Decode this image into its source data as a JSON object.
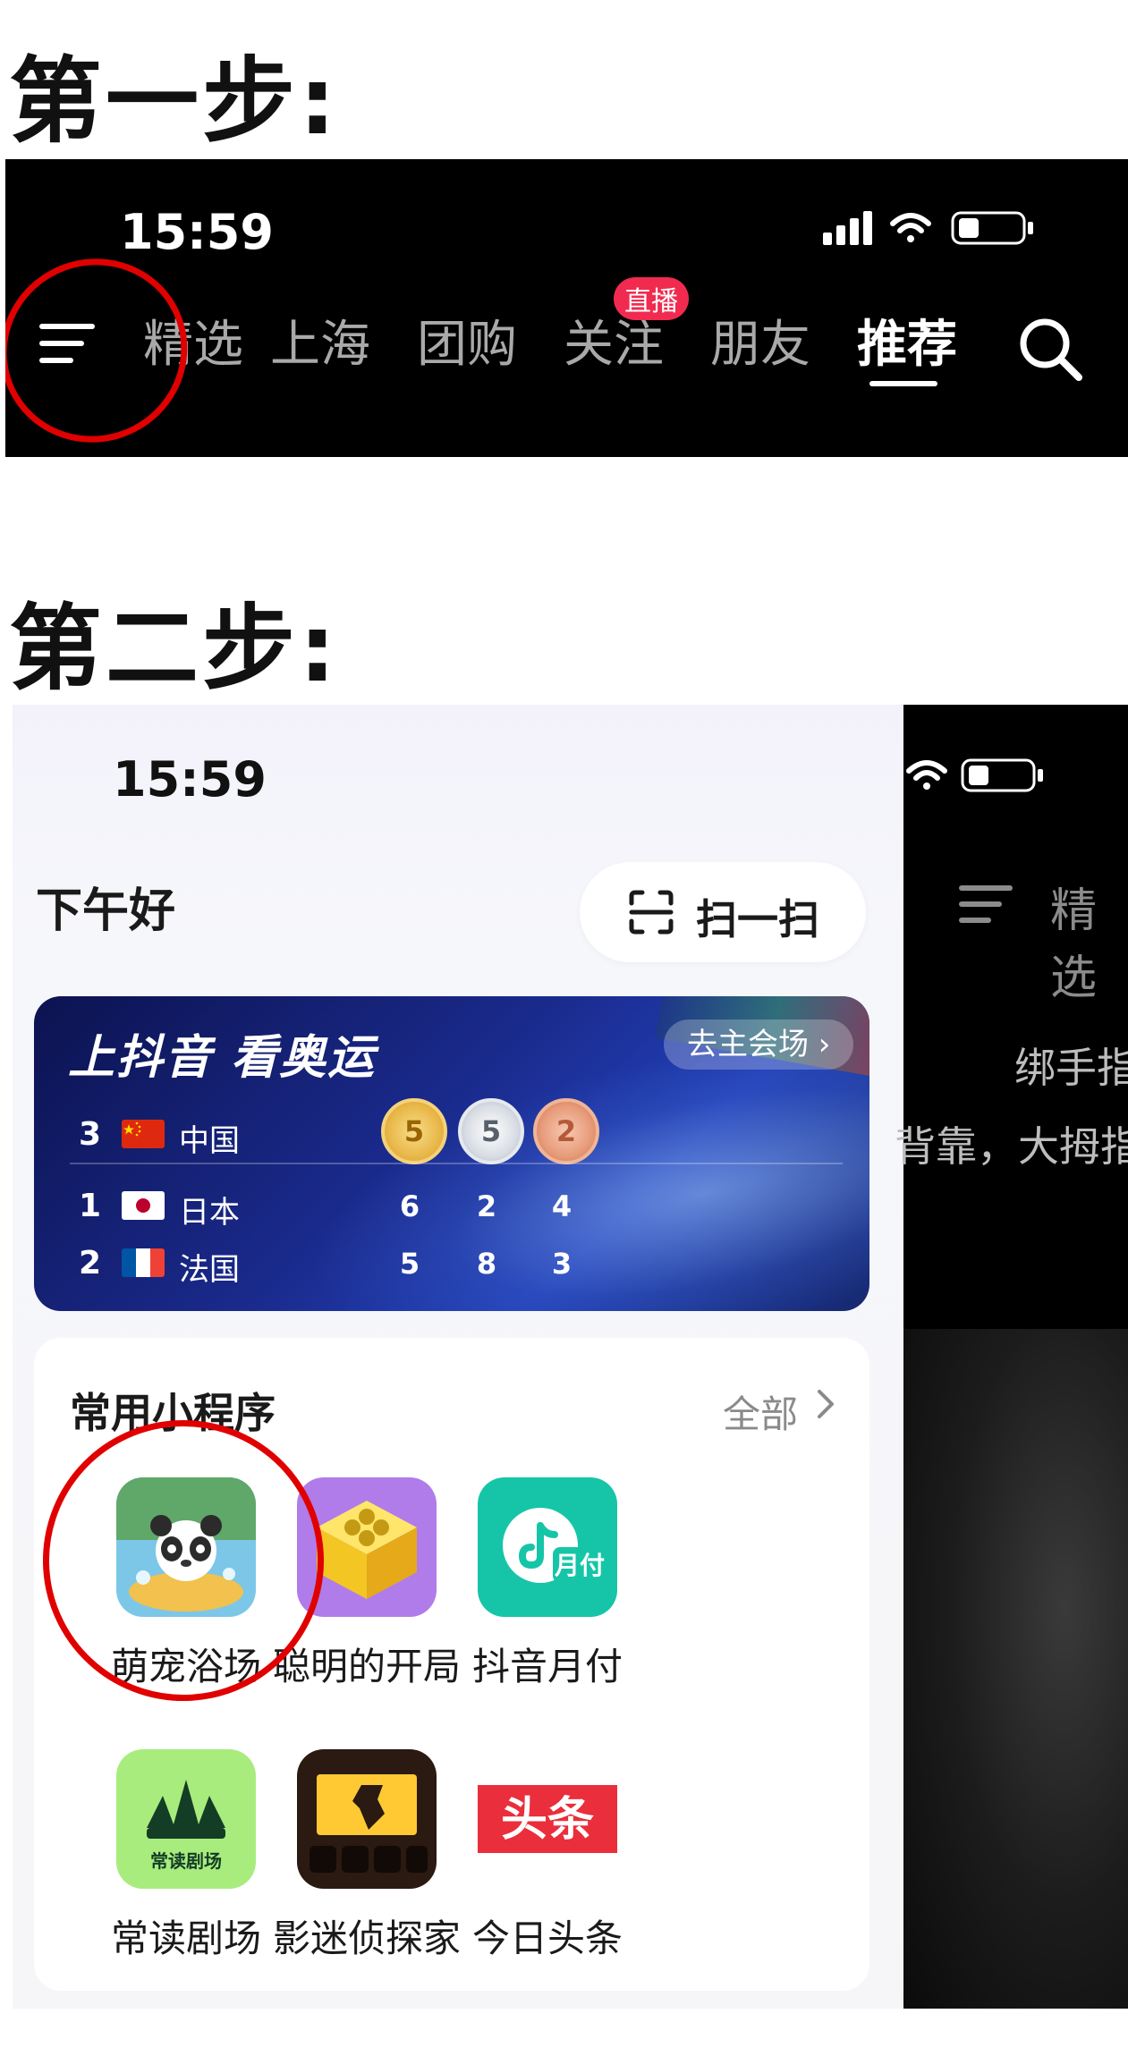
{
  "steps": {
    "step1_title": "第一步:",
    "step2_title": "第二步:"
  },
  "step1": {
    "time": "15:59",
    "nav_tabs": [
      "精选",
      "上海",
      "团购",
      "关注",
      "朋友",
      "推荐"
    ],
    "active_tab": "推荐",
    "live_badge": "直播",
    "icons": [
      "menu-icon",
      "search-icon",
      "signal-icon",
      "wifi-icon",
      "battery-icon"
    ],
    "highlight_color": "#e10000"
  },
  "step2": {
    "time": "15:59",
    "greeting": "下午好",
    "scan_label": "扫一扫",
    "olympics": {
      "title": "上抖音 看奥运",
      "link": "去主会场 ›",
      "rows": [
        {
          "rank": "3",
          "country": "中国",
          "gold": "5",
          "silver": "5",
          "bronze": "2"
        },
        {
          "rank": "1",
          "country": "日本",
          "gold": "6",
          "silver": "2",
          "bronze": "4"
        },
        {
          "rank": "2",
          "country": "法国",
          "gold": "5",
          "silver": "8",
          "bronze": "3"
        }
      ]
    },
    "mini_programs": {
      "title": "常用小程序",
      "all_label": "全部",
      "apps": [
        {
          "name": "萌宠浴场",
          "icon": "panda-bath-icon"
        },
        {
          "name": "聪明的开局",
          "icon": "yellow-box-icon"
        },
        {
          "name": "抖音月付",
          "icon": "douyin-monthly-pay-icon",
          "icon_text": "月付"
        },
        {
          "name": "常读剧场",
          "icon": "changdu-theater-icon",
          "icon_text": "常读剧场"
        },
        {
          "name": "影迷侦探家",
          "icon": "cinema-detective-icon"
        },
        {
          "name": "今日头条",
          "icon": "toutiao-icon",
          "icon_text": "头条"
        }
      ]
    },
    "feed": {
      "tab_partial": "精选",
      "line1": "绑手指",
      "line2": "背靠，大拇指"
    }
  }
}
